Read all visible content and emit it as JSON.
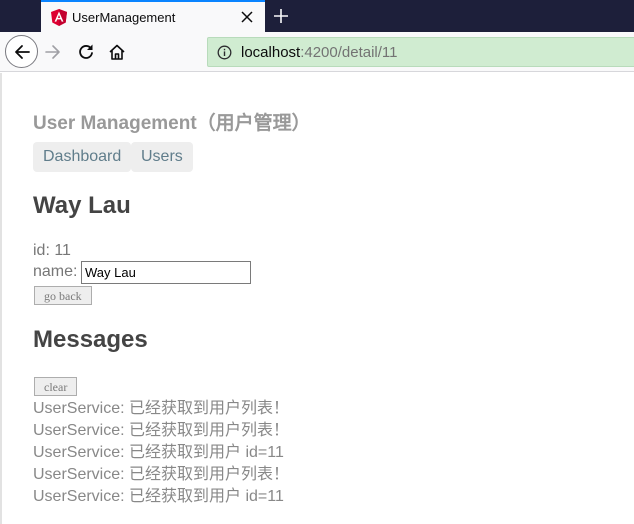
{
  "browser": {
    "tab": {
      "title": "UserManagement",
      "favicon": "angular-icon"
    },
    "url": {
      "host": "localhost",
      "path": ":4200/detail/11"
    }
  },
  "app": {
    "title": "User Management（用户管理）",
    "nav": [
      {
        "label": "Dashboard"
      },
      {
        "label": "Users"
      }
    ]
  },
  "hero": {
    "heading": "Way Lau",
    "id_label": "id: ",
    "id_value": "11",
    "name_label": "name:",
    "name_value": "Way Lau",
    "back_label": "go back"
  },
  "messages": {
    "heading": "Messages",
    "clear_label": "clear",
    "items": [
      "UserService: 已经获取到用户列表！",
      "UserService: 已经获取到用户列表！",
      "UserService: 已经获取到用户 id=11",
      "UserService: 已经获取到用户列表！",
      "UserService: 已经获取到用户 id=11"
    ]
  },
  "colors": {
    "accent": "#0a84ff",
    "url_secure_bg": "#d0ecd1",
    "nav_link_text": "#607d8b"
  }
}
